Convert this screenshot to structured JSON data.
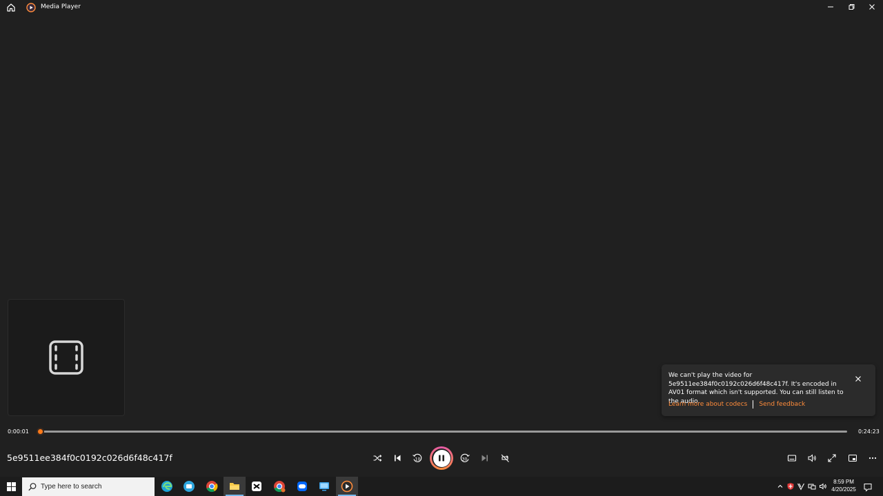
{
  "window": {
    "title": "Media Player",
    "home_icon": "home-icon",
    "app_icon": "media-player-icon",
    "controls": [
      "minimize-icon",
      "maximize-icon",
      "close-icon"
    ]
  },
  "thumbnail": {
    "icon": "film-icon"
  },
  "notification": {
    "message": "We can't play the video for 5e9511ee384f0c0192c026d6f48c417f. It's encoded in AV01 format which isn't supported. You can still listen to the audio.",
    "learn_more": "Learn more about codecs",
    "feedback": "Send feedback",
    "link_color": "#ff8c3b"
  },
  "seek": {
    "current_time": "0:00:01",
    "total_time": "0:24:23",
    "progress_fraction": 0.0007,
    "accent": "#ff7a1a"
  },
  "player": {
    "now_playing": "5e9511ee384f0c0192c026d6f48c417f",
    "controls": [
      "shuffle-icon",
      "previous-icon",
      "rewind-10-icon",
      "pause-icon",
      "forward-30-icon",
      "next-icon",
      "repeat-off-icon"
    ],
    "right_controls": [
      "captions-icon",
      "volume-icon",
      "fullscreen-icon",
      "miniplayer-icon",
      "more-icon"
    ],
    "skip_back_label": "10",
    "skip_forward_label": "30"
  },
  "taskbar": {
    "search_placeholder": "Type here to search",
    "apps": [
      "edge-icon",
      "telegram-icon",
      "chrome-icon",
      "file-explorer-icon",
      "capcut-icon",
      "chrome-profile-icon",
      "zalo-icon",
      "remote-desktop-icon",
      "media-player-icon"
    ],
    "active_app": "media-player-icon",
    "time": "8:59 PM",
    "date": "4/20/2025"
  }
}
